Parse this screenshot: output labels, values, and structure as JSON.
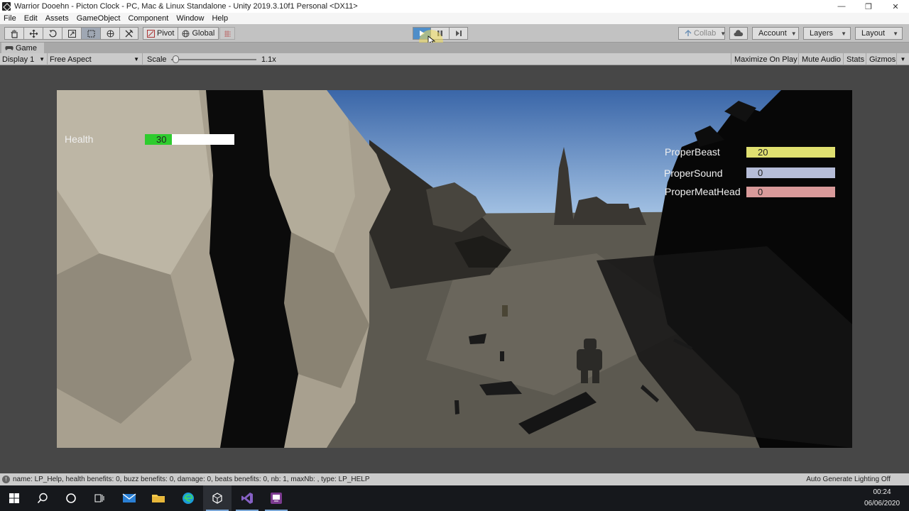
{
  "window": {
    "title": "Warrior Dooehn - Picton Clock - PC, Mac & Linux Standalone - Unity 2019.3.10f1 Personal <DX11>",
    "controls": [
      "—",
      "❐",
      "✕"
    ]
  },
  "menu": [
    "File",
    "Edit",
    "Assets",
    "GameObject",
    "Component",
    "Window",
    "Help"
  ],
  "toolbar": {
    "tools": [
      "hand-icon",
      "move-icon",
      "rotate-icon",
      "scale-icon",
      "rect-icon",
      "transform-icon",
      "custom-tool-icon"
    ],
    "pivot_label": "Pivot",
    "global_label": "Global",
    "collab_label": "Collab",
    "account_label": "Account",
    "layers_label": "Layers",
    "layout_label": "Layout"
  },
  "tab": {
    "label": "Game"
  },
  "gamebar": {
    "display_label": "Display 1",
    "aspect_label": "Free Aspect",
    "scale_label": "Scale",
    "scale_value": "1.1x",
    "maximize_label": "Maximize On Play",
    "mute_label": "Mute Audio",
    "stats_label": "Stats",
    "gizmos_label": "Gizmos"
  },
  "hud": {
    "health": {
      "label": "Health",
      "value": "30",
      "fraction": 0.3,
      "color": "#2ecc2e"
    },
    "meters": [
      {
        "label": "ProperBeast",
        "value": "20",
        "color": "#e0e070",
        "fraction": 1.0
      },
      {
        "label": "ProperSound",
        "value": "0",
        "color": "#b6bdd8",
        "fraction": 1.0
      },
      {
        "label": "ProperMeatHead",
        "value": "0",
        "color": "#d99a9a",
        "fraction": 1.0
      }
    ]
  },
  "status": {
    "text": "name: LP_Help, health benefits: 0, buzz benefits: 0, damage: 0, beats benefits: 0, nb: 1, maxNb: , type: LP_HELP",
    "right": "Auto Generate Lighting Off"
  },
  "taskbar": {
    "time": "00:24",
    "date": "06/06/2020"
  },
  "colors": {
    "toolbar": "#c2c2c2",
    "play_active": "#4f8ec9",
    "viewport_bg": "#474747"
  }
}
